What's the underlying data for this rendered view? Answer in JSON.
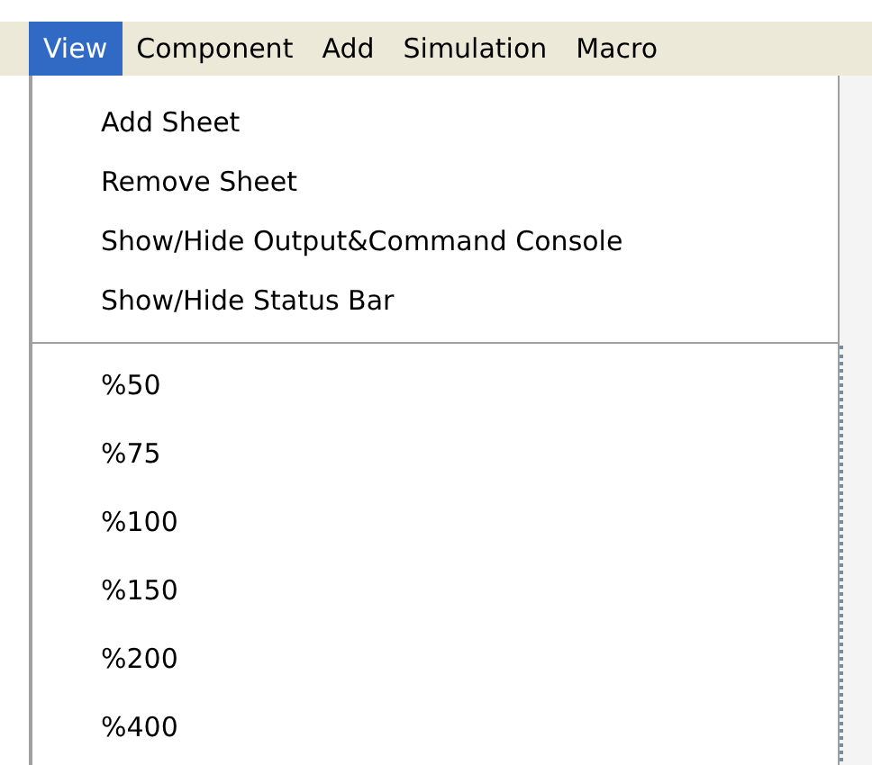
{
  "menu_bar": [
    {
      "label": "View",
      "selected": true
    },
    {
      "label": "Component",
      "selected": false
    },
    {
      "label": "Add",
      "selected": false
    },
    {
      "label": "Simulation",
      "selected": false
    },
    {
      "label": "Macro",
      "selected": false
    }
  ],
  "dropdown": {
    "groups": [
      {
        "items": [
          "Add Sheet",
          "Remove Sheet",
          "Show/Hide Output&Command Console",
          "Show/Hide Status Bar"
        ]
      },
      {
        "items": [
          "%50",
          "%75",
          "%100",
          "%150",
          "%200",
          "%400"
        ]
      }
    ]
  }
}
